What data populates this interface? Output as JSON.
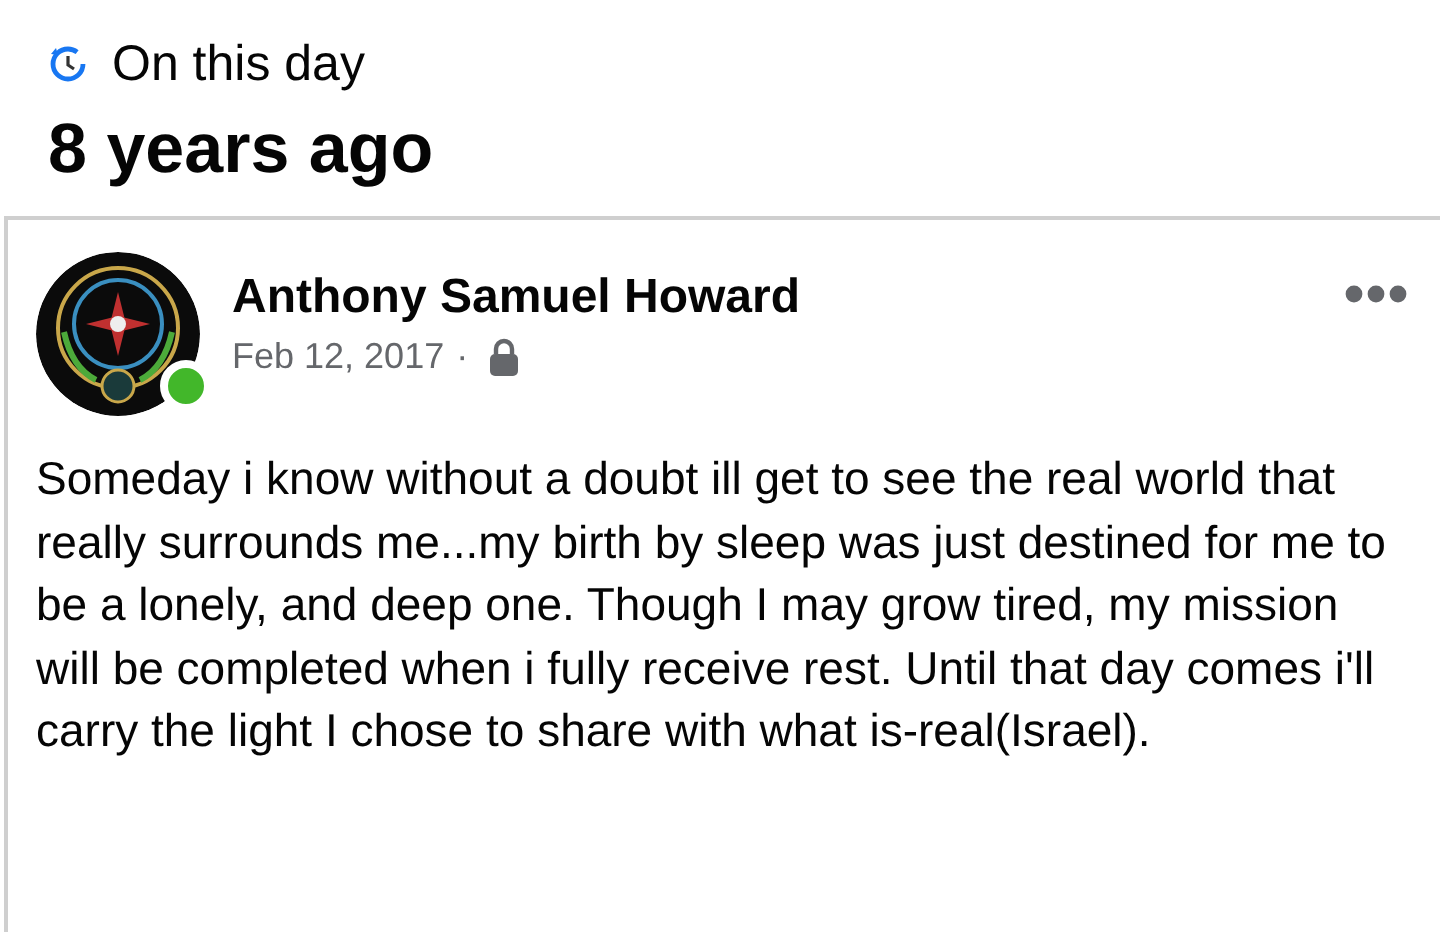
{
  "header": {
    "label": "On this day",
    "title": "8 years ago"
  },
  "post": {
    "author": "Anthony Samuel Howard",
    "online": true,
    "date": "Feb 12, 2017",
    "separator": "·",
    "text": "Someday i know without a doubt ill get to see the real world that really surrounds me...my birth by sleep was just destined for me to be a lonely, and deep one. Though I may grow tired, my mission will be completed when i fully receive rest. Until that day comes i'll carry the light I chose to share with what is-real(Israel)."
  }
}
